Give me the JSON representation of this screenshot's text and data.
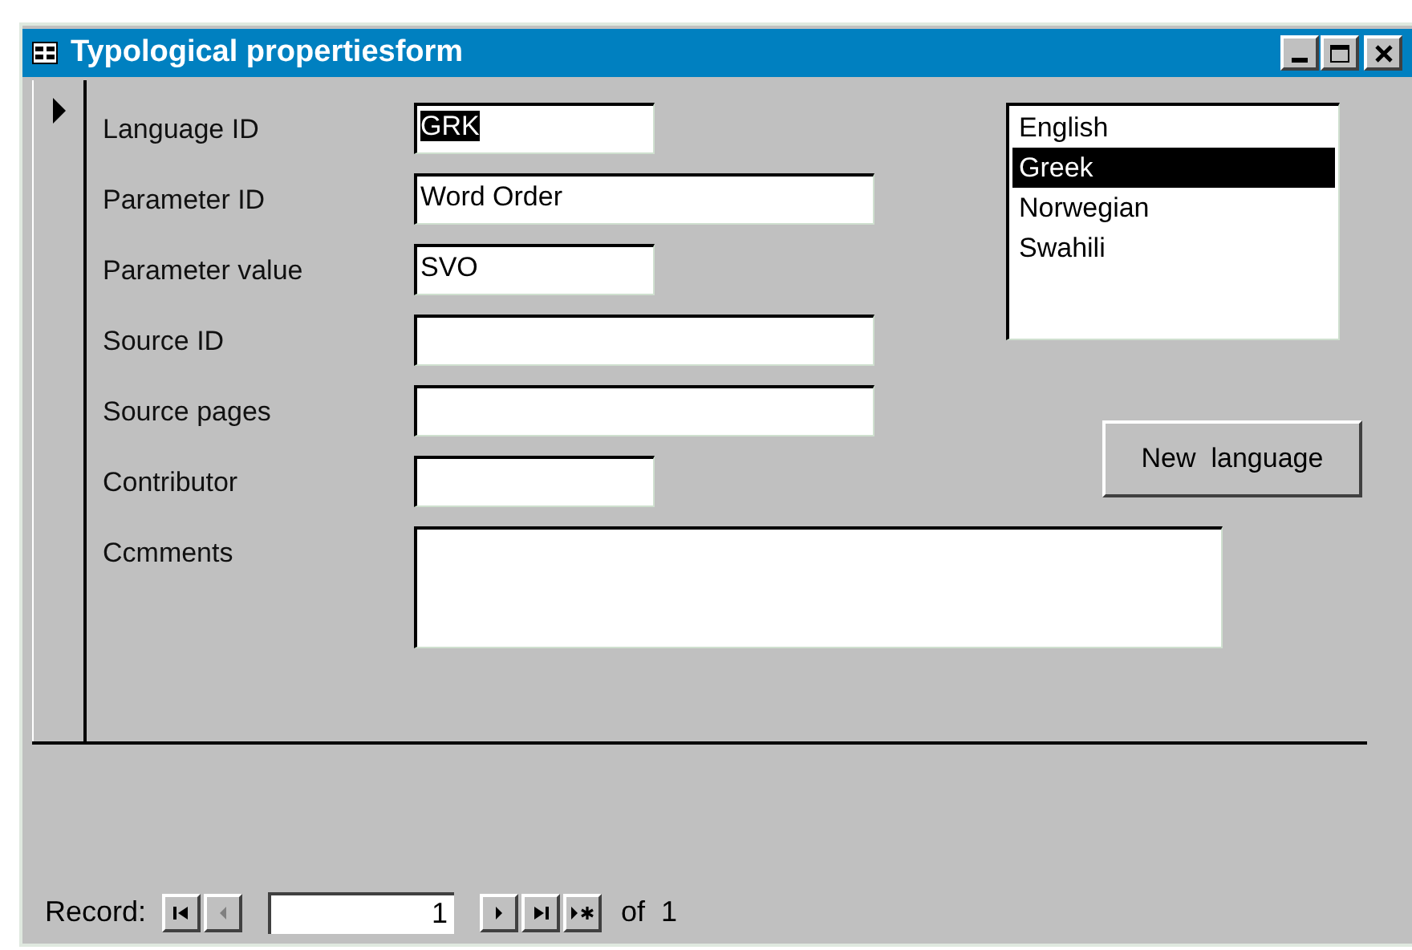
{
  "window": {
    "title": "Typological propertiesform"
  },
  "record_selector": {
    "current": true
  },
  "fields": [
    {
      "label": "Language ID",
      "value": "GRK",
      "kind": "short",
      "highlighted": true
    },
    {
      "label": "Parameter ID",
      "value": "Word Order",
      "kind": "long",
      "highlighted": false
    },
    {
      "label": "Parameter value",
      "value": "SVO",
      "kind": "short",
      "highlighted": false
    },
    {
      "label": "Source ID",
      "kind": "long"
    },
    {
      "label": "Source pages",
      "kind": "long"
    },
    {
      "label": "Contributor",
      "kind": "short"
    },
    {
      "label": "Ccmments",
      "kind": "area"
    }
  ],
  "language_list": [
    {
      "label": "English",
      "selected": false
    },
    {
      "label": "Greek",
      "selected": true
    },
    {
      "label": "Norwegian",
      "selected": false
    },
    {
      "label": "Swahili",
      "selected": false
    }
  ],
  "new_language_button": "New  language",
  "navigation": {
    "label": "Record:",
    "record": "1",
    "of": "of  1",
    "buttons": [
      {
        "kind": "first",
        "disabled": false
      },
      {
        "kind": "previous",
        "disabled": true
      },
      {
        "kind": "next",
        "disabled": false
      },
      {
        "kind": "last",
        "disabled": false
      },
      {
        "kind": "new",
        "disabled": false
      }
    ]
  }
}
